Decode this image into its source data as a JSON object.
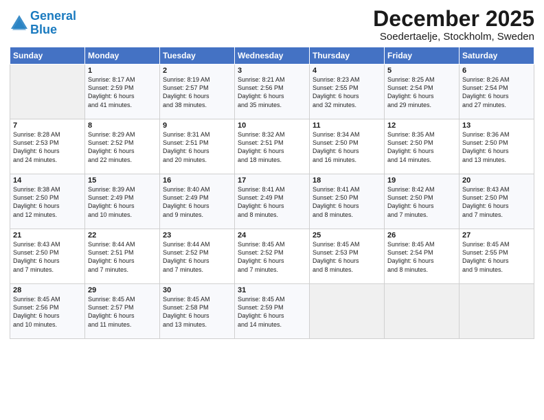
{
  "header": {
    "logo_line1": "General",
    "logo_line2": "Blue",
    "title": "December 2025",
    "subtitle": "Soedertaelje, Stockholm, Sweden"
  },
  "weekdays": [
    "Sunday",
    "Monday",
    "Tuesday",
    "Wednesday",
    "Thursday",
    "Friday",
    "Saturday"
  ],
  "weeks": [
    [
      {
        "num": "",
        "info": ""
      },
      {
        "num": "1",
        "info": "Sunrise: 8:17 AM\nSunset: 2:59 PM\nDaylight: 6 hours\nand 41 minutes."
      },
      {
        "num": "2",
        "info": "Sunrise: 8:19 AM\nSunset: 2:57 PM\nDaylight: 6 hours\nand 38 minutes."
      },
      {
        "num": "3",
        "info": "Sunrise: 8:21 AM\nSunset: 2:56 PM\nDaylight: 6 hours\nand 35 minutes."
      },
      {
        "num": "4",
        "info": "Sunrise: 8:23 AM\nSunset: 2:55 PM\nDaylight: 6 hours\nand 32 minutes."
      },
      {
        "num": "5",
        "info": "Sunrise: 8:25 AM\nSunset: 2:54 PM\nDaylight: 6 hours\nand 29 minutes."
      },
      {
        "num": "6",
        "info": "Sunrise: 8:26 AM\nSunset: 2:54 PM\nDaylight: 6 hours\nand 27 minutes."
      }
    ],
    [
      {
        "num": "7",
        "info": "Sunrise: 8:28 AM\nSunset: 2:53 PM\nDaylight: 6 hours\nand 24 minutes."
      },
      {
        "num": "8",
        "info": "Sunrise: 8:29 AM\nSunset: 2:52 PM\nDaylight: 6 hours\nand 22 minutes."
      },
      {
        "num": "9",
        "info": "Sunrise: 8:31 AM\nSunset: 2:51 PM\nDaylight: 6 hours\nand 20 minutes."
      },
      {
        "num": "10",
        "info": "Sunrise: 8:32 AM\nSunset: 2:51 PM\nDaylight: 6 hours\nand 18 minutes."
      },
      {
        "num": "11",
        "info": "Sunrise: 8:34 AM\nSunset: 2:50 PM\nDaylight: 6 hours\nand 16 minutes."
      },
      {
        "num": "12",
        "info": "Sunrise: 8:35 AM\nSunset: 2:50 PM\nDaylight: 6 hours\nand 14 minutes."
      },
      {
        "num": "13",
        "info": "Sunrise: 8:36 AM\nSunset: 2:50 PM\nDaylight: 6 hours\nand 13 minutes."
      }
    ],
    [
      {
        "num": "14",
        "info": "Sunrise: 8:38 AM\nSunset: 2:50 PM\nDaylight: 6 hours\nand 12 minutes."
      },
      {
        "num": "15",
        "info": "Sunrise: 8:39 AM\nSunset: 2:49 PM\nDaylight: 6 hours\nand 10 minutes."
      },
      {
        "num": "16",
        "info": "Sunrise: 8:40 AM\nSunset: 2:49 PM\nDaylight: 6 hours\nand 9 minutes."
      },
      {
        "num": "17",
        "info": "Sunrise: 8:41 AM\nSunset: 2:49 PM\nDaylight: 6 hours\nand 8 minutes."
      },
      {
        "num": "18",
        "info": "Sunrise: 8:41 AM\nSunset: 2:50 PM\nDaylight: 6 hours\nand 8 minutes."
      },
      {
        "num": "19",
        "info": "Sunrise: 8:42 AM\nSunset: 2:50 PM\nDaylight: 6 hours\nand 7 minutes."
      },
      {
        "num": "20",
        "info": "Sunrise: 8:43 AM\nSunset: 2:50 PM\nDaylight: 6 hours\nand 7 minutes."
      }
    ],
    [
      {
        "num": "21",
        "info": "Sunrise: 8:43 AM\nSunset: 2:50 PM\nDaylight: 6 hours\nand 7 minutes."
      },
      {
        "num": "22",
        "info": "Sunrise: 8:44 AM\nSunset: 2:51 PM\nDaylight: 6 hours\nand 7 minutes."
      },
      {
        "num": "23",
        "info": "Sunrise: 8:44 AM\nSunset: 2:52 PM\nDaylight: 6 hours\nand 7 minutes."
      },
      {
        "num": "24",
        "info": "Sunrise: 8:45 AM\nSunset: 2:52 PM\nDaylight: 6 hours\nand 7 minutes."
      },
      {
        "num": "25",
        "info": "Sunrise: 8:45 AM\nSunset: 2:53 PM\nDaylight: 6 hours\nand 8 minutes."
      },
      {
        "num": "26",
        "info": "Sunrise: 8:45 AM\nSunset: 2:54 PM\nDaylight: 6 hours\nand 8 minutes."
      },
      {
        "num": "27",
        "info": "Sunrise: 8:45 AM\nSunset: 2:55 PM\nDaylight: 6 hours\nand 9 minutes."
      }
    ],
    [
      {
        "num": "28",
        "info": "Sunrise: 8:45 AM\nSunset: 2:56 PM\nDaylight: 6 hours\nand 10 minutes."
      },
      {
        "num": "29",
        "info": "Sunrise: 8:45 AM\nSunset: 2:57 PM\nDaylight: 6 hours\nand 11 minutes."
      },
      {
        "num": "30",
        "info": "Sunrise: 8:45 AM\nSunset: 2:58 PM\nDaylight: 6 hours\nand 13 minutes."
      },
      {
        "num": "31",
        "info": "Sunrise: 8:45 AM\nSunset: 2:59 PM\nDaylight: 6 hours\nand 14 minutes."
      },
      {
        "num": "",
        "info": ""
      },
      {
        "num": "",
        "info": ""
      },
      {
        "num": "",
        "info": ""
      }
    ]
  ]
}
